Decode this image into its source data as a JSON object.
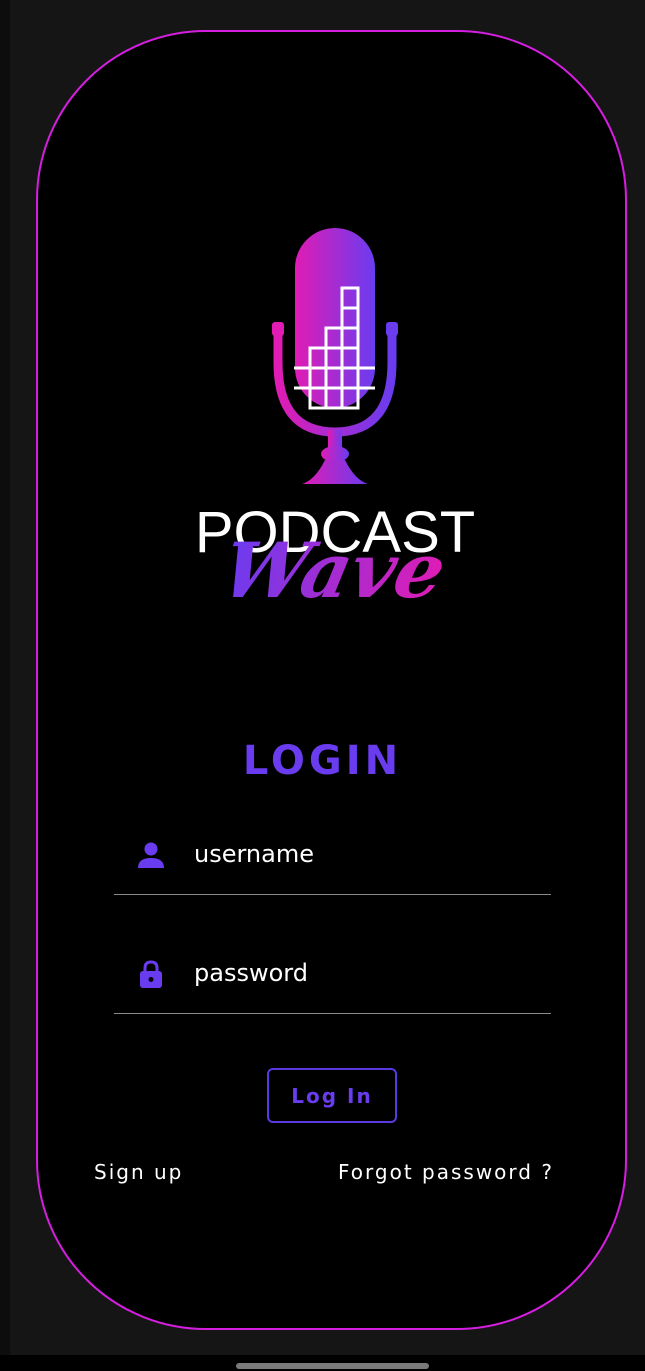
{
  "app": {
    "brand_line1": "PODCAST",
    "brand_line2": "Wave",
    "colors": {
      "accent": "#6a3cf0",
      "border": "#d51ee0",
      "gradient_start": "#e01cb4",
      "gradient_end": "#6a3cf0"
    }
  },
  "login": {
    "title": "LOGIN",
    "username": {
      "placeholder": "username",
      "value": "",
      "icon": "person-icon"
    },
    "password": {
      "placeholder": "password",
      "value": "",
      "icon": "lock-icon"
    },
    "submit_label": "Log In",
    "signup_label": "Sign up",
    "forgot_label": "Forgot password ?"
  }
}
